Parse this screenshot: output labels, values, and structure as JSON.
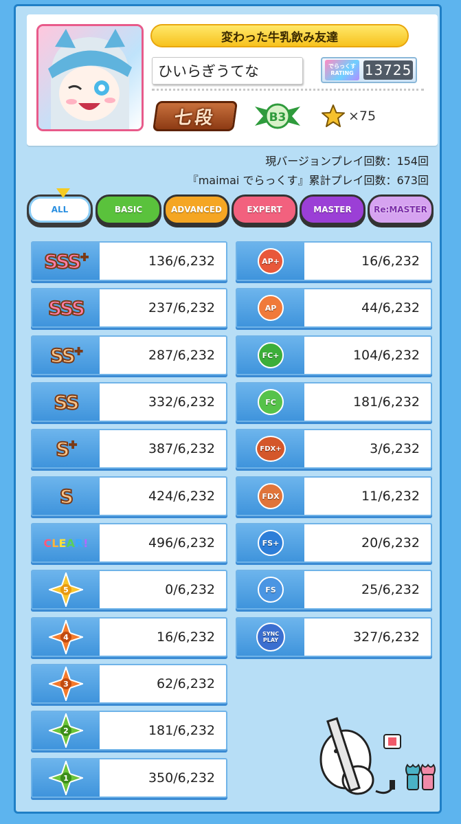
{
  "profile": {
    "title": "変わった牛乳飲み友達",
    "name": "ひいらぎうてな",
    "rating_label_top": "でらっくす",
    "rating_label_bottom": "RATING",
    "rating": "13725",
    "dan": "七段",
    "class": "B3",
    "stars": "×75"
  },
  "play_info": {
    "current": "現バージョンプレイ回数：154回",
    "total": "『maimai でらっくす』累計プレイ回数：673回"
  },
  "tabs": [
    {
      "label": "ALL",
      "color": "#ffffff"
    },
    {
      "label": "BASIC",
      "color": "#5ac23c"
    },
    {
      "label": "ADVANCED",
      "color": "#f5a623"
    },
    {
      "label": "EXPERT",
      "color": "#f2617e"
    },
    {
      "label": "MASTER",
      "color": "#9b3fd6"
    },
    {
      "label": "Re:MASTER",
      "color": "#d6a3f0"
    }
  ],
  "left_stats": [
    {
      "icon": "sss-plus",
      "label": "SSS",
      "value": "136/6,232"
    },
    {
      "icon": "sss",
      "label": "SSS",
      "value": "237/6,232"
    },
    {
      "icon": "ss-plus",
      "label": "SS",
      "value": "287/6,232"
    },
    {
      "icon": "ss",
      "label": "SS",
      "value": "332/6,232"
    },
    {
      "icon": "s-plus",
      "label": "S",
      "value": "387/6,232"
    },
    {
      "icon": "s",
      "label": "S",
      "value": "424/6,232"
    },
    {
      "icon": "clear",
      "label": "CLEAR!",
      "value": "496/6,232"
    },
    {
      "icon": "dx-star-5",
      "label": "5",
      "value": "0/6,232"
    },
    {
      "icon": "dx-star-4",
      "label": "4",
      "value": "16/6,232"
    },
    {
      "icon": "dx-star-3",
      "label": "3",
      "value": "62/6,232"
    },
    {
      "icon": "dx-star-2",
      "label": "2",
      "value": "181/6,232"
    },
    {
      "icon": "dx-star-1",
      "label": "1",
      "value": "350/6,232"
    }
  ],
  "right_stats": [
    {
      "icon": "ap-plus",
      "label": "AP+",
      "value": "16/6,232"
    },
    {
      "icon": "ap",
      "label": "AP",
      "value": "44/6,232"
    },
    {
      "icon": "fc-plus",
      "label": "FC+",
      "value": "104/6,232"
    },
    {
      "icon": "fc",
      "label": "FC",
      "value": "181/6,232"
    },
    {
      "icon": "fdx-plus",
      "label": "FDX+",
      "value": "3/6,232"
    },
    {
      "icon": "fdx",
      "label": "FDX",
      "value": "11/6,232"
    },
    {
      "icon": "fs-plus",
      "label": "FS+",
      "value": "20/6,232"
    },
    {
      "icon": "fs",
      "label": "FS",
      "value": "25/6,232"
    },
    {
      "icon": "sync-play",
      "label": "SYNC PLAY",
      "value": "327/6,232"
    }
  ]
}
